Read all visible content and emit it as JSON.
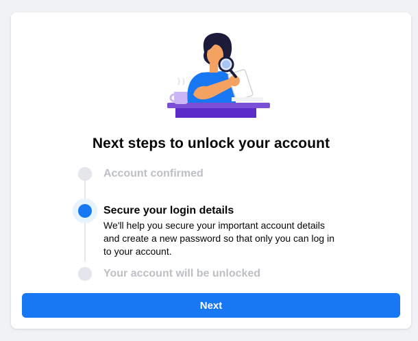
{
  "title": "Next steps to unlock your account",
  "steps": [
    {
      "label": "Account confirmed",
      "state": "done"
    },
    {
      "label": "Secure your login details",
      "state": "current",
      "description": "We'll help you secure your important account details and create a new password so that only you can log in to your account."
    },
    {
      "label": "Your account will be unlocked",
      "state": "pending"
    }
  ],
  "next_button": {
    "label": "Next"
  },
  "colors": {
    "accent": "#1877f2",
    "background": "#f0f2f5",
    "inactive": "#bcc0c4"
  },
  "illustration": {
    "icon": "person-with-magnifying-glass-illustration"
  }
}
